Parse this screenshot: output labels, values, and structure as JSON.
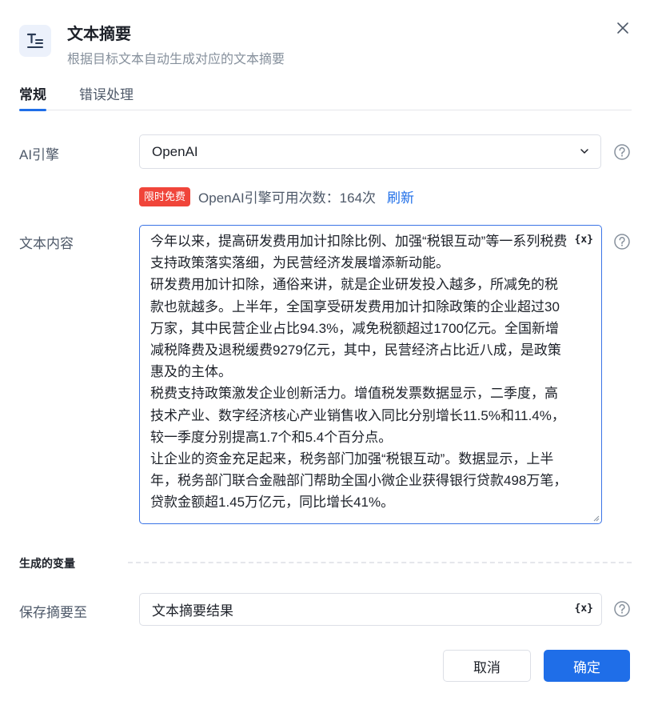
{
  "dialog": {
    "title": "文本摘要",
    "subtitle": "根据目标文本自动生成对应的文本摘要"
  },
  "tabs": [
    {
      "label": "常规",
      "active": true
    },
    {
      "label": "错误处理",
      "active": false
    }
  ],
  "ai_engine": {
    "label": "AI引擎",
    "value": "OpenAI"
  },
  "quota": {
    "badge": "限时免费",
    "text": "OpenAI引擎可用次数：164次",
    "refresh": "刷新"
  },
  "content": {
    "label": "文本内容",
    "var_icon": "{x}",
    "text": "今年以来，提高研发费用加计扣除比例、加强“税银互动”等一系列税费支持政策落实落细，为民营经济发展增添新动能。\n研发费用加计扣除，通俗来讲，就是企业研发投入越多，所减免的税款也就越多。上半年，全国享受研发费用加计扣除政策的企业超过30万家，其中民营企业占比94.3%，减免税额超过1700亿元。全国新增减税降费及退税缓费9279亿元，其中，民营经济占比近八成，是政策惠及的主体。\n税费支持政策激发企业创新活力。增值税发票数据显示，二季度，高技术产业、数字经济核心产业销售收入同比分别增长11.5%和11.4%，较一季度分别提高1.7个和5.4个百分点。\n让企业的资金充足起来，税务部门加强“税银互动”。数据显示，上半年，税务部门联合金融部门帮助全国小微企业获得银行贷款498万笔，贷款金额超1.45万亿元，同比增长41%。"
  },
  "section": {
    "title": "生成的变量"
  },
  "output": {
    "label": "保存摘要至",
    "value": "文本摘要结果",
    "var_icon": "{x}"
  },
  "buttons": {
    "cancel": "取消",
    "confirm": "确定"
  },
  "colors": {
    "accent": "#1f6ee8",
    "badge": "#f0453a"
  }
}
